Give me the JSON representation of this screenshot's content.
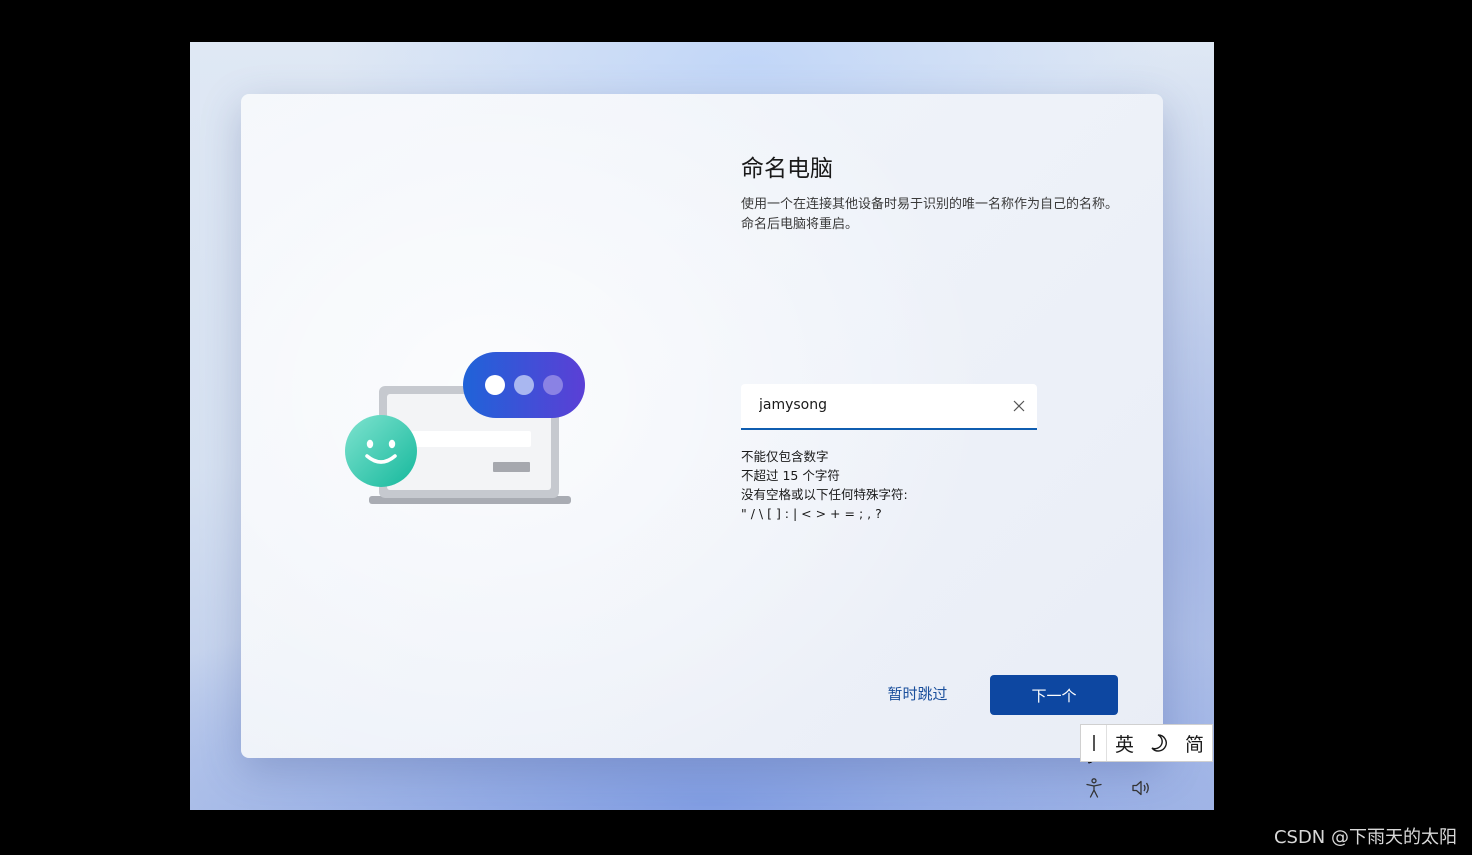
{
  "setup": {
    "title": "命名电脑",
    "description": "使用一个在连接其他设备时易于识别的唯一名称作为自己的名称。命名后电脑将重启。",
    "name_field": {
      "value": "jamysong",
      "placeholder": ""
    },
    "rules": [
      "不能仅包含数字",
      "不超过 15 个字符",
      "没有空格或以下任何特殊字符:",
      "\" / \\ [ ] : | < > + = ; , ?"
    ],
    "skip_label": "暂时跳过",
    "next_label": "下一个"
  },
  "ime_toolbar": {
    "mode_label": "英",
    "width_icon": "half-width-moon-icon",
    "charset_label": "简"
  },
  "footer_icons": {
    "accessibility": "accessibility-icon",
    "volume": "volume-icon"
  },
  "colors": {
    "primary_button": "#0d47a1",
    "link": "#1a4f9c",
    "input_underline": "#0f5db0",
    "avatar_teal": "#2fd0b4",
    "bubble_blue": "#1f63d8",
    "bubble_purple": "#5b3fd6"
  },
  "watermark": "CSDN @下雨天的太阳"
}
